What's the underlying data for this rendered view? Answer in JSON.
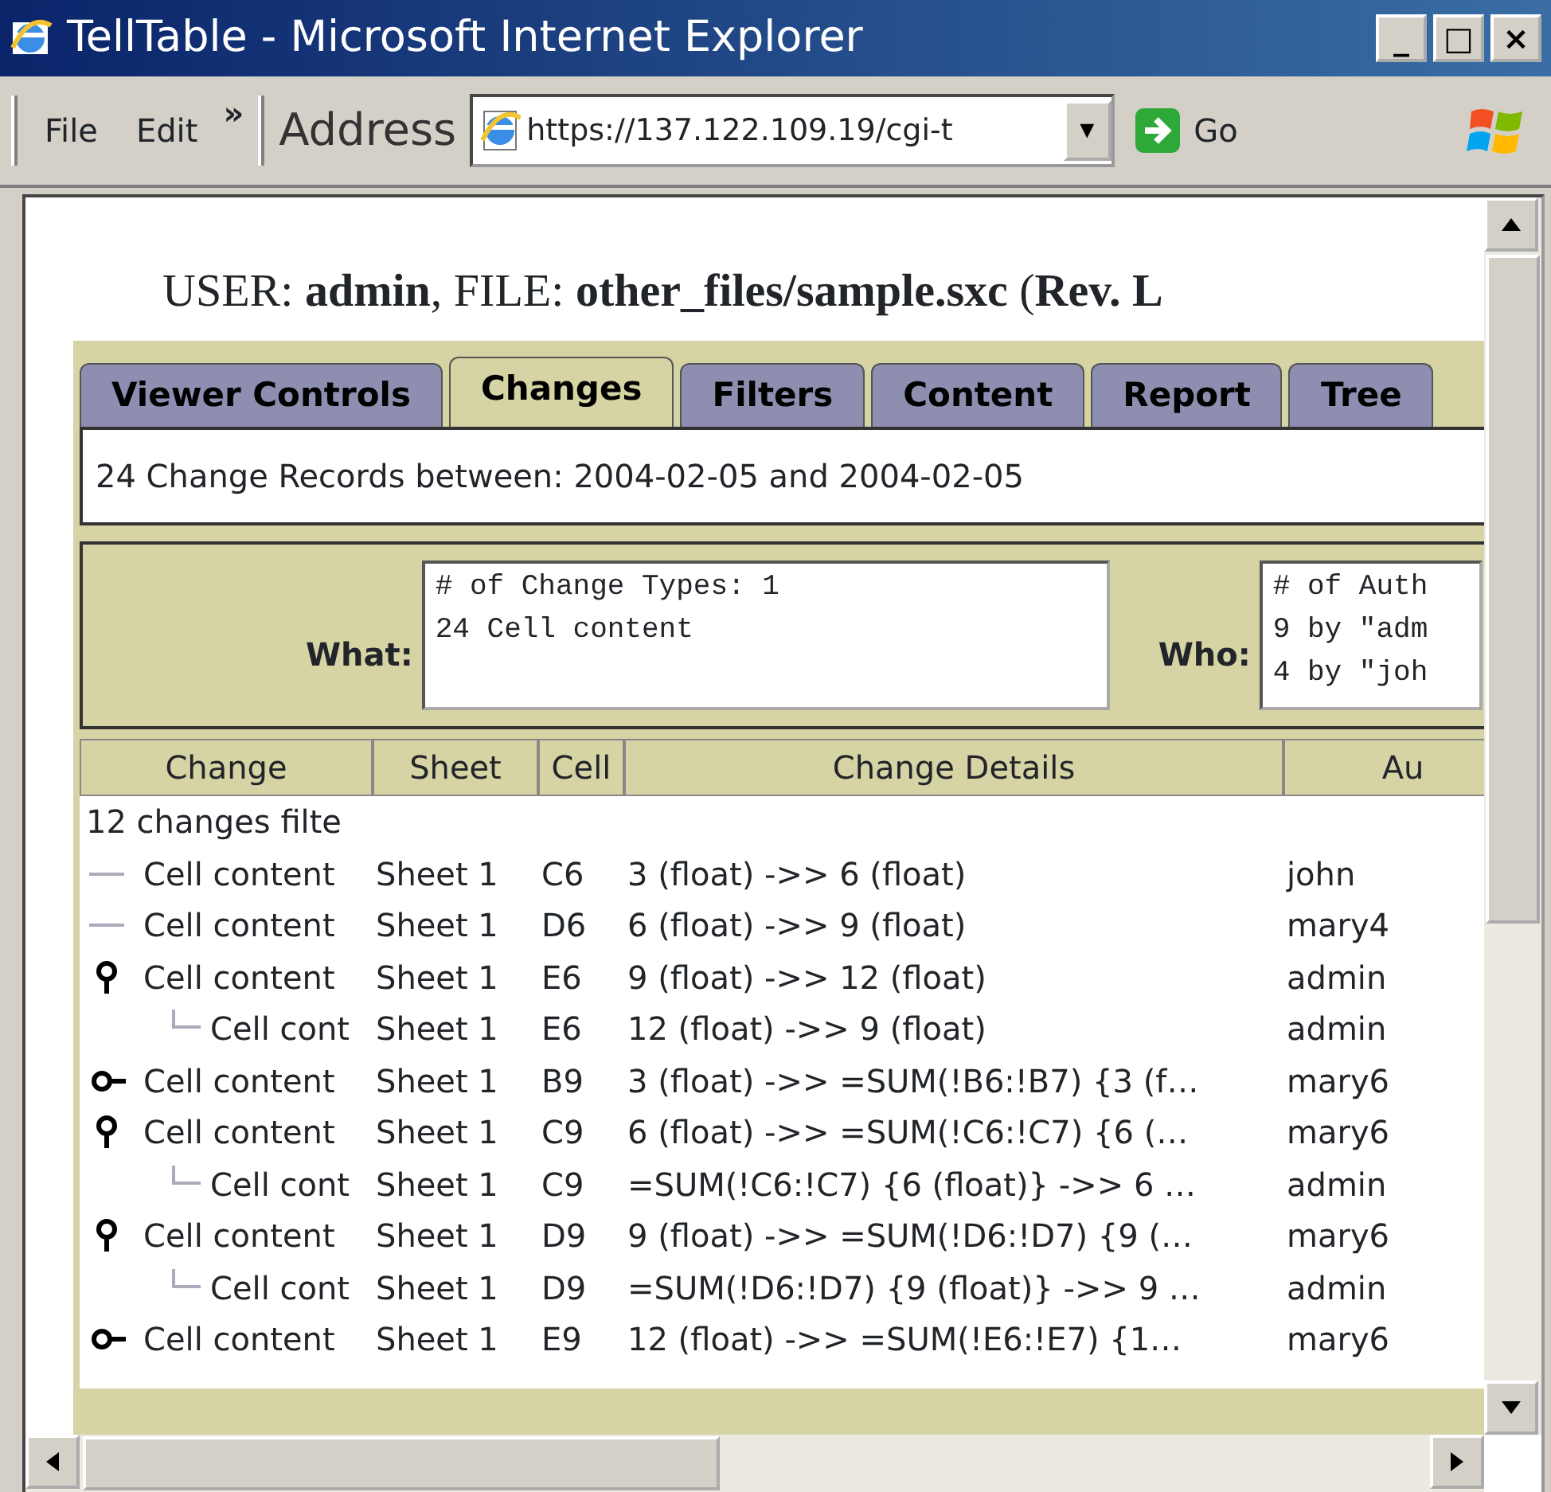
{
  "window": {
    "title": "TellTable - Microsoft Internet Explorer",
    "controls": [
      "_",
      "□",
      "×"
    ]
  },
  "toolbar": {
    "menus": [
      "File",
      "Edit"
    ],
    "chevron": "»",
    "address_label": "Address",
    "address": "https://137.122.109.19/cgi-t",
    "dropdown": "▾",
    "go": "Go"
  },
  "heading": "USER: **admin**, FILE: **other_files/sample.sxc** (**Rev. L**",
  "tabs": [
    {
      "label": "Viewer Controls",
      "selected": false
    },
    {
      "label": "Changes",
      "selected": true
    },
    {
      "label": "Filters",
      "selected": false
    },
    {
      "label": "Content",
      "selected": false
    },
    {
      "label": "Report",
      "selected": false
    },
    {
      "label": "Tree",
      "selected": false
    }
  ],
  "summary": "24 Change Records between: 2004-02-05 and 2004-02-05",
  "what": {
    "label": "What:",
    "lines": [
      "# of Change Types: 1",
      "24 Cell content"
    ]
  },
  "who": {
    "label": "Who:",
    "lines": [
      "# of Auth",
      "9 by \"adm",
      "4 by \"joh"
    ]
  },
  "table": {
    "columns": [
      "Change",
      "Sheet",
      "Cell",
      "Change Details",
      "Au"
    ],
    "root": "12 changes filte",
    "rows": [
      {
        "change": "Cell content",
        "sheet": "Sheet 1",
        "cell": "C6",
        "details": "3 (float) ->> 6 (float)",
        "author": "john"
      },
      {
        "change": "Cell content",
        "sheet": "Sheet 1",
        "cell": "D6",
        "details": "6 (float) ->> 9 (float)",
        "author": "mary4"
      },
      {
        "change": "Cell content",
        "sheet": "Sheet 1",
        "cell": "E6",
        "details": "9 (float) ->> 12 (float)",
        "author": "admin",
        "expanded": true,
        "children": [
          {
            "change": "Cell cont",
            "sheet": "Sheet 1",
            "cell": "E6",
            "details": "12 (float) ->> 9 (float)",
            "author": "admin"
          }
        ]
      },
      {
        "change": "Cell content",
        "sheet": "Sheet 1",
        "cell": "B9",
        "details": "3 (float) ->> =SUM(!B6:!B7) {3 (f…",
        "author": "mary6",
        "expanded": false
      },
      {
        "change": "Cell content",
        "sheet": "Sheet 1",
        "cell": "C9",
        "details": "6 (float) ->> =SUM(!C6:!C7) {6 (…",
        "author": "mary6",
        "expanded": true,
        "children": [
          {
            "change": "Cell cont",
            "sheet": "Sheet 1",
            "cell": "C9",
            "details": "=SUM(!C6:!C7) {6 (float)} ->> 6 …",
            "author": "admin"
          }
        ]
      },
      {
        "change": "Cell content",
        "sheet": "Sheet 1",
        "cell": "D9",
        "details": "9 (float) ->> =SUM(!D6:!D7) {9 (…",
        "author": "mary6",
        "expanded": true,
        "children": [
          {
            "change": "Cell cont",
            "sheet": "Sheet 1",
            "cell": "D9",
            "details": "=SUM(!D6:!D7) {9 (float)} ->> 9 …",
            "author": "admin"
          }
        ]
      },
      {
        "change": "Cell content",
        "sheet": "Sheet 1",
        "cell": "E9",
        "details": "12 (float) ->> =SUM(!E6:!E7) {1…",
        "author": "mary6",
        "expanded": false
      }
    ]
  }
}
